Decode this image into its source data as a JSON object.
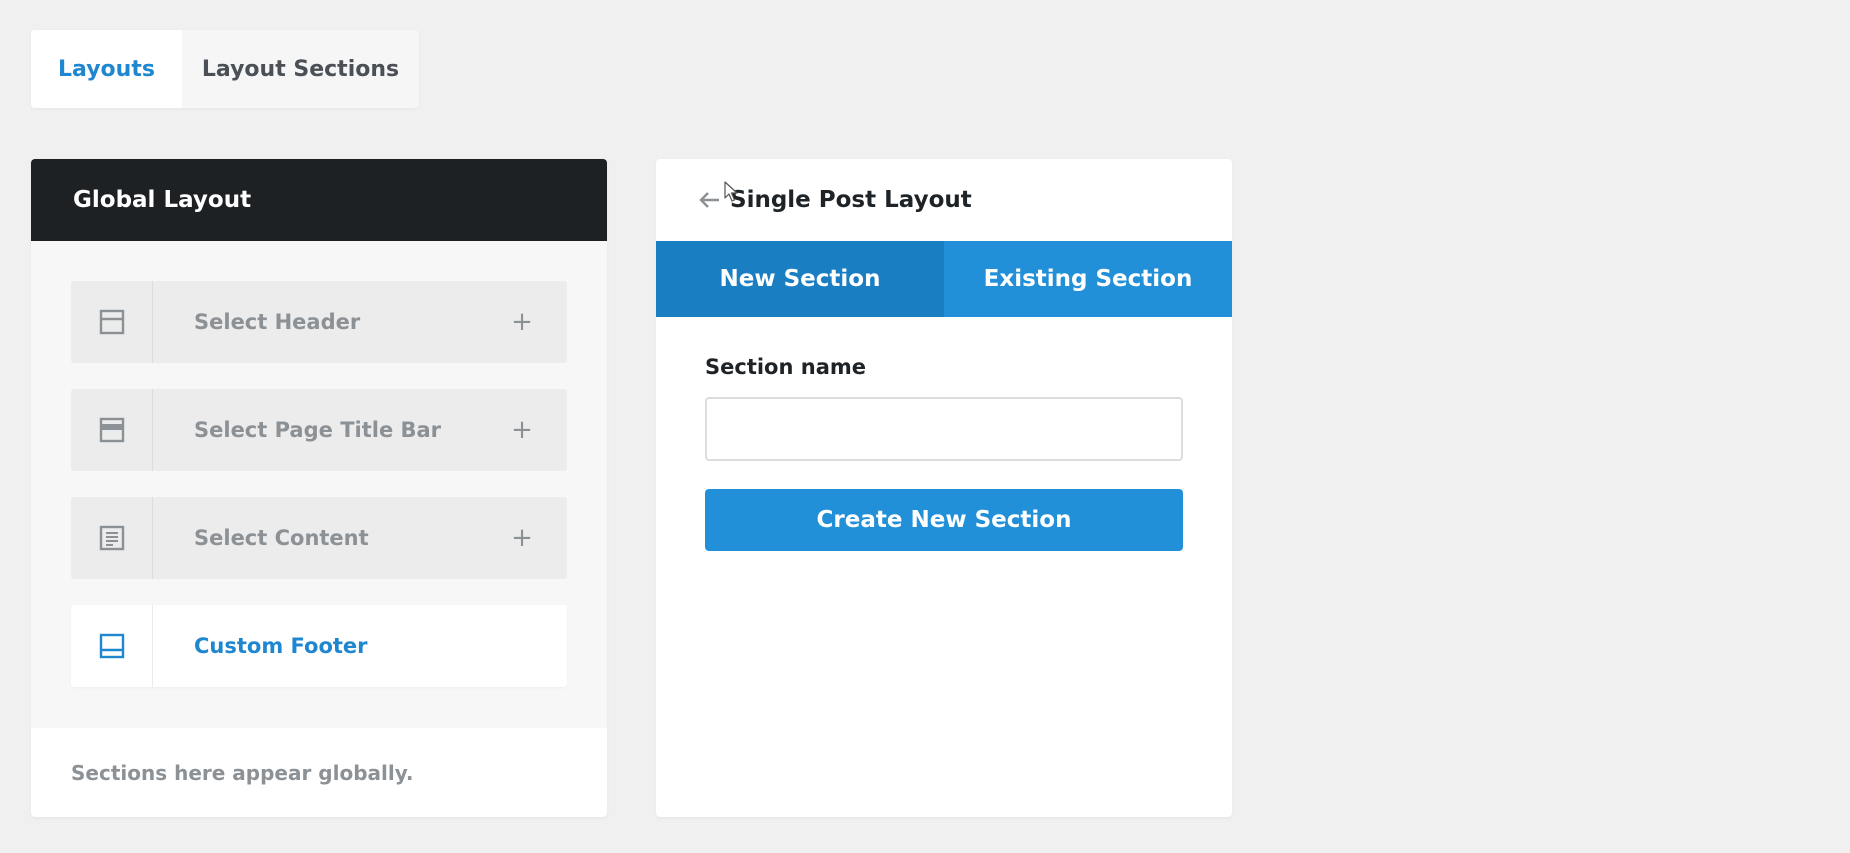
{
  "top_tabs": {
    "layouts": "Layouts",
    "layout_sections": "Layout Sections"
  },
  "global_layout": {
    "title": "Global Layout",
    "slots": [
      {
        "label": "Select Header",
        "icon": "header-layout-icon",
        "action": "+"
      },
      {
        "label": "Select Page Title Bar",
        "icon": "page-title-bar-icon",
        "action": "+"
      },
      {
        "label": "Select Content",
        "icon": "content-layout-icon",
        "action": "+"
      },
      {
        "label": "Custom Footer",
        "icon": "footer-layout-icon"
      }
    ],
    "footer_note": "Sections here appear globally."
  },
  "single_post_layout": {
    "title": "Single Post Layout",
    "tabs": {
      "new": "New Section",
      "existing": "Existing Section"
    },
    "form": {
      "label": "Section name",
      "value": "",
      "placeholder": "",
      "button": "Create New Section"
    }
  },
  "colors": {
    "accent": "#1f87cf",
    "dark_header": "#1d2124",
    "tab_active": "#1a7ec2",
    "tab_inactive": "#2290d8",
    "muted_text": "#8c9196",
    "background": "#f0f0f0"
  }
}
